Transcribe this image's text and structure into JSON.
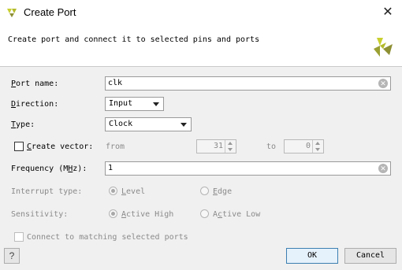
{
  "window": {
    "title": "Create Port",
    "close_glyph": "✕"
  },
  "header": {
    "subtitle": "Create port and connect it to selected pins and ports",
    "logo_icon": "vivado-logo-icon"
  },
  "form": {
    "port_name": {
      "label_key": "P",
      "label_rest": "ort name:",
      "value": "clk"
    },
    "direction": {
      "label_key": "D",
      "label_rest": "irection:",
      "value": "Input"
    },
    "type": {
      "label_key": "T",
      "label_rest": "ype:",
      "value": "Clock"
    },
    "create_vector": {
      "label_key": "C",
      "label_rest": "reate vector:",
      "checked": false,
      "from_label": "from",
      "from_value": "31",
      "to_label": "to",
      "to_value": "0"
    },
    "frequency": {
      "label_pre": "Frequency (M",
      "label_key": "H",
      "label_post": "z):",
      "value": "1"
    },
    "interrupt_type": {
      "label": "Interrupt type:",
      "opt1_key": "L",
      "opt1_rest": "evel",
      "opt2_key": "E",
      "opt2_rest": "dge",
      "selected": "Level"
    },
    "sensitivity": {
      "label": "Sensitivity:",
      "opt1_key": "A",
      "opt1_rest": "ctive High",
      "opt2_pre": "A",
      "opt2_key": "c",
      "opt2_rest": "tive Low",
      "selected": "Active High"
    },
    "connect_matching": {
      "label": "Connect to matching selected ports",
      "checked": false
    }
  },
  "footer": {
    "help_label": "?",
    "ok_label": "OK",
    "cancel_label": "Cancel"
  },
  "colors": {
    "logo_yellow": "#c8cf2e",
    "logo_dark": "#8d8f33",
    "ok_border": "#3c7fb1"
  }
}
